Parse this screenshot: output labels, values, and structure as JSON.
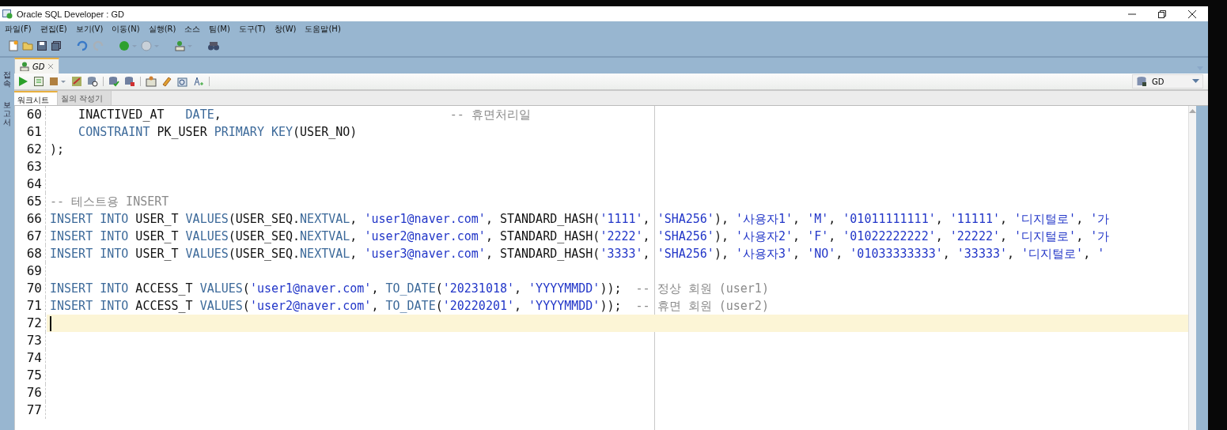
{
  "window": {
    "title": "Oracle SQL Developer : GD"
  },
  "menu": [
    {
      "label": "파일(F)"
    },
    {
      "label": "편집(E)"
    },
    {
      "label": "보기(V)"
    },
    {
      "label": "이동(N)"
    },
    {
      "label": "실행(R)"
    },
    {
      "label": "소스"
    },
    {
      "label": "팀(M)"
    },
    {
      "label": "도구(T)"
    },
    {
      "label": "창(W)"
    },
    {
      "label": "도움말(H)"
    }
  ],
  "side_tabs": [
    {
      "label": "접속"
    },
    {
      "label": "보고서"
    }
  ],
  "document_tab": {
    "label": "GD",
    "selected": true
  },
  "connection_select": {
    "value": "GD"
  },
  "sub_tabs": [
    {
      "label": "워크시트",
      "selected": true
    },
    {
      "label": "질의 작성기",
      "selected": false
    }
  ],
  "editor": {
    "lines": [
      {
        "number": "60",
        "current": false,
        "tokens": [
          {
            "kind": "plain",
            "text": "    INACTIVED_AT   "
          },
          {
            "kind": "keyword",
            "text": "DATE"
          },
          {
            "kind": "plain",
            "text": ",                                "
          },
          {
            "kind": "comment",
            "text": "-- 휴면처리일"
          }
        ]
      },
      {
        "number": "61",
        "current": false,
        "tokens": [
          {
            "kind": "keyword",
            "text": "    CONSTRAINT"
          },
          {
            "kind": "plain",
            "text": " PK_USER "
          },
          {
            "kind": "keyword",
            "text": "PRIMARY KEY"
          },
          {
            "kind": "plain",
            "text": "(USER_NO)"
          }
        ]
      },
      {
        "number": "62",
        "current": false,
        "tokens": [
          {
            "kind": "plain",
            "text": ");"
          }
        ]
      },
      {
        "number": "63",
        "current": false
      },
      {
        "number": "64",
        "current": false
      },
      {
        "number": "65",
        "current": false,
        "tokens": [
          {
            "kind": "comment",
            "text": "-- 테스트용 INSERT"
          }
        ]
      },
      {
        "number": "66",
        "current": false,
        "tokens": [
          {
            "kind": "keyword",
            "text": "INSERT INTO"
          },
          {
            "kind": "plain",
            "text": " USER_T "
          },
          {
            "kind": "keyword",
            "text": "VALUES"
          },
          {
            "kind": "plain",
            "text": "(USER_SEQ."
          },
          {
            "kind": "keyword",
            "text": "NEXTVAL"
          },
          {
            "kind": "plain",
            "text": ", "
          },
          {
            "kind": "string",
            "text": "'user1@naver.com'"
          },
          {
            "kind": "plain",
            "text": ", STANDARD_HASH("
          },
          {
            "kind": "string",
            "text": "'1111'"
          },
          {
            "kind": "plain",
            "text": ", "
          },
          {
            "kind": "string",
            "text": "'SHA256'"
          },
          {
            "kind": "plain",
            "text": "), "
          },
          {
            "kind": "string",
            "text": "'사용자1'"
          },
          {
            "kind": "plain",
            "text": ", "
          },
          {
            "kind": "string",
            "text": "'M'"
          },
          {
            "kind": "plain",
            "text": ", "
          },
          {
            "kind": "string",
            "text": "'01011111111'"
          },
          {
            "kind": "plain",
            "text": ", "
          },
          {
            "kind": "string",
            "text": "'11111'"
          },
          {
            "kind": "plain",
            "text": ", "
          },
          {
            "kind": "string",
            "text": "'디지털로'"
          },
          {
            "kind": "plain",
            "text": ", "
          },
          {
            "kind": "string",
            "text": "'가"
          }
        ]
      },
      {
        "number": "67",
        "current": false,
        "tokens": [
          {
            "kind": "keyword",
            "text": "INSERT INTO"
          },
          {
            "kind": "plain",
            "text": " USER_T "
          },
          {
            "kind": "keyword",
            "text": "VALUES"
          },
          {
            "kind": "plain",
            "text": "(USER_SEQ."
          },
          {
            "kind": "keyword",
            "text": "NEXTVAL"
          },
          {
            "kind": "plain",
            "text": ", "
          },
          {
            "kind": "string",
            "text": "'user2@naver.com'"
          },
          {
            "kind": "plain",
            "text": ", STANDARD_HASH("
          },
          {
            "kind": "string",
            "text": "'2222'"
          },
          {
            "kind": "plain",
            "text": ", "
          },
          {
            "kind": "string",
            "text": "'SHA256'"
          },
          {
            "kind": "plain",
            "text": "), "
          },
          {
            "kind": "string",
            "text": "'사용자2'"
          },
          {
            "kind": "plain",
            "text": ", "
          },
          {
            "kind": "string",
            "text": "'F'"
          },
          {
            "kind": "plain",
            "text": ", "
          },
          {
            "kind": "string",
            "text": "'01022222222'"
          },
          {
            "kind": "plain",
            "text": ", "
          },
          {
            "kind": "string",
            "text": "'22222'"
          },
          {
            "kind": "plain",
            "text": ", "
          },
          {
            "kind": "string",
            "text": "'디지털로'"
          },
          {
            "kind": "plain",
            "text": ", "
          },
          {
            "kind": "string",
            "text": "'가"
          }
        ]
      },
      {
        "number": "68",
        "current": false,
        "tokens": [
          {
            "kind": "keyword",
            "text": "INSERT INTO"
          },
          {
            "kind": "plain",
            "text": " USER_T "
          },
          {
            "kind": "keyword",
            "text": "VALUES"
          },
          {
            "kind": "plain",
            "text": "(USER_SEQ."
          },
          {
            "kind": "keyword",
            "text": "NEXTVAL"
          },
          {
            "kind": "plain",
            "text": ", "
          },
          {
            "kind": "string",
            "text": "'user3@naver.com'"
          },
          {
            "kind": "plain",
            "text": ", STANDARD_HASH("
          },
          {
            "kind": "string",
            "text": "'3333'"
          },
          {
            "kind": "plain",
            "text": ", "
          },
          {
            "kind": "string",
            "text": "'SHA256'"
          },
          {
            "kind": "plain",
            "text": "), "
          },
          {
            "kind": "string",
            "text": "'사용자3'"
          },
          {
            "kind": "plain",
            "text": ", "
          },
          {
            "kind": "string",
            "text": "'NO'"
          },
          {
            "kind": "plain",
            "text": ", "
          },
          {
            "kind": "string",
            "text": "'01033333333'"
          },
          {
            "kind": "plain",
            "text": ", "
          },
          {
            "kind": "string",
            "text": "'33333'"
          },
          {
            "kind": "plain",
            "text": ", "
          },
          {
            "kind": "string",
            "text": "'디지털로'"
          },
          {
            "kind": "plain",
            "text": ", "
          },
          {
            "kind": "string",
            "text": "'"
          }
        ]
      },
      {
        "number": "69",
        "current": false
      },
      {
        "number": "70",
        "current": false,
        "tokens": [
          {
            "kind": "keyword",
            "text": "INSERT INTO"
          },
          {
            "kind": "plain",
            "text": " ACCESS_T "
          },
          {
            "kind": "keyword",
            "text": "VALUES"
          },
          {
            "kind": "plain",
            "text": "("
          },
          {
            "kind": "string",
            "text": "'user1@naver.com'"
          },
          {
            "kind": "plain",
            "text": ", "
          },
          {
            "kind": "keyword",
            "text": "TO_DATE"
          },
          {
            "kind": "plain",
            "text": "("
          },
          {
            "kind": "string",
            "text": "'20231018'"
          },
          {
            "kind": "plain",
            "text": ", "
          },
          {
            "kind": "string",
            "text": "'YYYYMMDD'"
          },
          {
            "kind": "plain",
            "text": "));  "
          },
          {
            "kind": "comment",
            "text": "-- 정상 회원 (user1)"
          }
        ]
      },
      {
        "number": "71",
        "current": false,
        "tokens": [
          {
            "kind": "keyword",
            "text": "INSERT INTO"
          },
          {
            "kind": "plain",
            "text": " ACCESS_T "
          },
          {
            "kind": "keyword",
            "text": "VALUES"
          },
          {
            "kind": "plain",
            "text": "("
          },
          {
            "kind": "string",
            "text": "'user2@naver.com'"
          },
          {
            "kind": "plain",
            "text": ", "
          },
          {
            "kind": "keyword",
            "text": "TO_DATE"
          },
          {
            "kind": "plain",
            "text": "("
          },
          {
            "kind": "string",
            "text": "'20220201'"
          },
          {
            "kind": "plain",
            "text": ", "
          },
          {
            "kind": "string",
            "text": "'YYYYMMDD'"
          },
          {
            "kind": "plain",
            "text": "));  "
          },
          {
            "kind": "comment",
            "text": "-- 휴면 회원 (user2)"
          }
        ]
      },
      {
        "number": "72",
        "current": true
      },
      {
        "number": "73",
        "current": false
      },
      {
        "number": "74",
        "current": false
      },
      {
        "number": "75",
        "current": false
      },
      {
        "number": "76",
        "current": false
      },
      {
        "number": "77",
        "current": false
      }
    ]
  }
}
